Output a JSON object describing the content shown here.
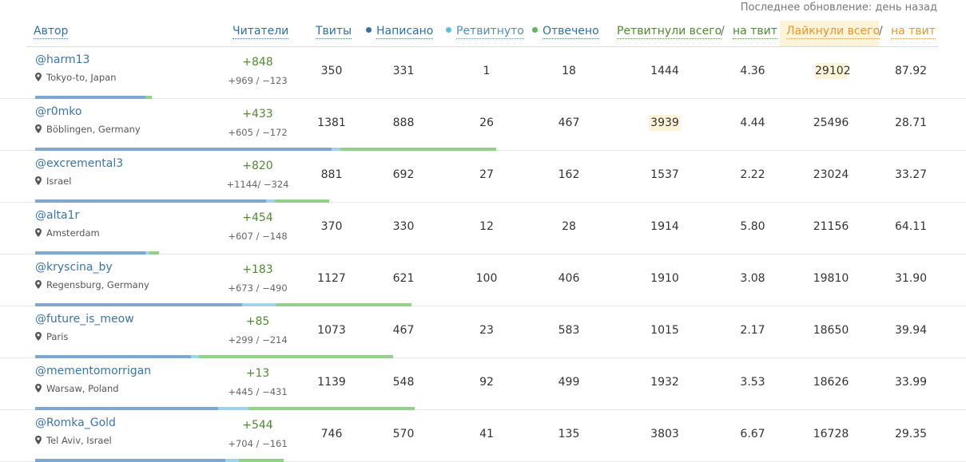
{
  "last_update": "Последнее обновление: день назад",
  "header": {
    "author": "Автор",
    "followers": "Читатели",
    "tweets": "Твиты",
    "written": "Написано",
    "retweeted": "Ретвитнуто",
    "replied": "Отвечено",
    "retweets_total": "Ретвитнули всего",
    "per_tweet_1": "на твит",
    "likes_total": "Лайкнули всего",
    "per_tweet_2": "на твит",
    "slash": "/"
  },
  "colors": {
    "written": "#3a6ea5",
    "retweeted": "#5bc0de",
    "replied": "#5cb85c",
    "highlight": "#fdf3d8"
  },
  "rows": [
    {
      "handle": "@harm13",
      "location": "Tokyo-to, Japan",
      "followers_delta": "+848",
      "followers_change": "+969 / −123",
      "tweets": "350",
      "written": "331",
      "retweeted": "1",
      "replied": "18",
      "retweets_total": "1444",
      "rt_per_tweet": "4.36",
      "likes_total": "29102",
      "likes_per_tweet": "87.92",
      "highlight": "likes"
    },
    {
      "handle": "@r0mko",
      "location": "Böblingen, Germany",
      "followers_delta": "+433",
      "followers_change": "+605 / −172",
      "tweets": "1381",
      "written": "888",
      "retweeted": "26",
      "replied": "467",
      "retweets_total": "3939",
      "rt_per_tweet": "4.44",
      "likes_total": "25496",
      "likes_per_tweet": "28.71",
      "highlight": "retweets"
    },
    {
      "handle": "@excremental3",
      "location": "Israel",
      "followers_delta": "+820",
      "followers_change": "+1144/ −324",
      "tweets": "881",
      "written": "692",
      "retweeted": "27",
      "replied": "162",
      "retweets_total": "1537",
      "rt_per_tweet": "2.22",
      "likes_total": "23024",
      "likes_per_tweet": "33.27",
      "highlight": ""
    },
    {
      "handle": "@alta1r",
      "location": "Amsterdam",
      "followers_delta": "+454",
      "followers_change": "+607 / −148",
      "tweets": "370",
      "written": "330",
      "retweeted": "12",
      "replied": "28",
      "retweets_total": "1914",
      "rt_per_tweet": "5.80",
      "likes_total": "21156",
      "likes_per_tweet": "64.11",
      "highlight": ""
    },
    {
      "handle": "@kryscina_by",
      "location": "Regensburg, Germany",
      "followers_delta": "+183",
      "followers_change": "+673 / −490",
      "tweets": "1127",
      "written": "621",
      "retweeted": "100",
      "replied": "406",
      "retweets_total": "1910",
      "rt_per_tweet": "3.08",
      "likes_total": "19810",
      "likes_per_tweet": "31.90",
      "highlight": ""
    },
    {
      "handle": "@future_is_meow",
      "location": "Paris",
      "followers_delta": "+85",
      "followers_change": "+299 / −214",
      "tweets": "1073",
      "written": "467",
      "retweeted": "23",
      "replied": "583",
      "retweets_total": "1015",
      "rt_per_tweet": "2.17",
      "likes_total": "18650",
      "likes_per_tweet": "39.94",
      "highlight": ""
    },
    {
      "handle": "@mementomorrigan",
      "location": "Warsaw, Poland",
      "followers_delta": "+13",
      "followers_change": "+445 / −431",
      "tweets": "1139",
      "written": "548",
      "retweeted": "92",
      "replied": "499",
      "retweets_total": "1932",
      "rt_per_tweet": "3.53",
      "likes_total": "18626",
      "likes_per_tweet": "33.99",
      "highlight": ""
    },
    {
      "handle": "@Romka_Gold",
      "location": "Tel Aviv, Israel",
      "followers_delta": "+544",
      "followers_change": "+704 / −161",
      "tweets": "746",
      "written": "570",
      "retweeted": "41",
      "replied": "135",
      "retweets_total": "3803",
      "rt_per_tweet": "6.67",
      "likes_total": "16728",
      "likes_per_tweet": "29.35",
      "highlight": ""
    }
  ]
}
